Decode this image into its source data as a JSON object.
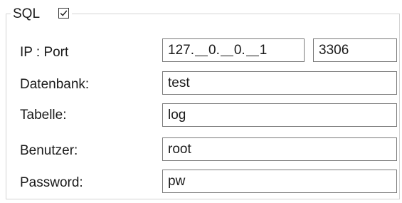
{
  "group": {
    "title": "SQL",
    "enabled_checked": true
  },
  "ip_port": {
    "label": "IP : Port",
    "ip_octets": [
      "127",
      "0",
      "0",
      "1"
    ],
    "port": "3306"
  },
  "database": {
    "label": "Datenbank:",
    "value": "test"
  },
  "table": {
    "label": "Tabelle:",
    "value": "log"
  },
  "user": {
    "label": "Benutzer:",
    "value": "root"
  },
  "password": {
    "label": "Password:",
    "value": "pw"
  }
}
